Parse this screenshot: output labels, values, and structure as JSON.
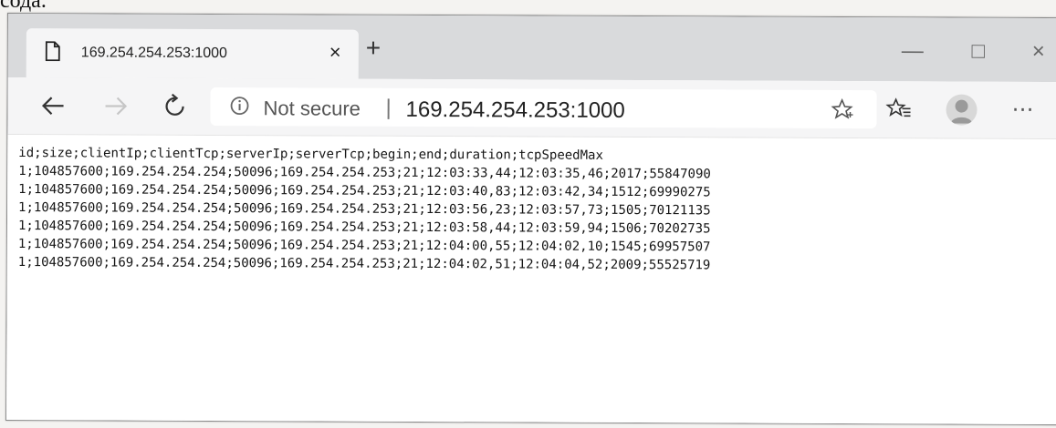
{
  "page_above_text": "сода.",
  "browser": {
    "tab": {
      "title": "169.254.254.253:1000",
      "close_label": "×",
      "page_icon": "page-icon"
    },
    "new_tab_label": "+",
    "window_controls": {
      "minimize": "—",
      "maximize": "□",
      "close": "×"
    },
    "toolbar": {
      "back_icon": "back-arrow-icon",
      "forward_icon": "forward-arrow-icon",
      "refresh_icon": "refresh-icon",
      "address": {
        "security_icon": "info-icon",
        "security_text": "Not secure",
        "separator": "|",
        "url": "169.254.254.253:1000"
      },
      "favorite_icon": "star-icon",
      "favorites_icon": "favorites-list-icon",
      "profile_icon": "profile-avatar-icon",
      "more_label": "⋯"
    }
  },
  "content": {
    "lines": [
      "id;size;clientIp;clientTcp;serverIp;serverTcp;begin;end;duration;tcpSpeedMax",
      "1;104857600;169.254.254.254;50096;169.254.254.253;21;12:03:33,44;12:03:35,46;2017;55847090",
      "1;104857600;169.254.254.254;50096;169.254.254.253;21;12:03:40,83;12:03:42,34;1512;69990275",
      "1;104857600;169.254.254.254;50096;169.254.254.253;21;12:03:56,23;12:03:57,73;1505;70121135",
      "1;104857600;169.254.254.254;50096;169.254.254.253;21;12:03:58,44;12:03:59,94;1506;70202735",
      "1;104857600;169.254.254.254;50096;169.254.254.253;21;12:04:00,55;12:04:02,10;1545;69957507",
      "1;104857600;169.254.254.254;50096;169.254.254.253;21;12:04:02,51;12:04:04,52;2009;55525719"
    ]
  }
}
